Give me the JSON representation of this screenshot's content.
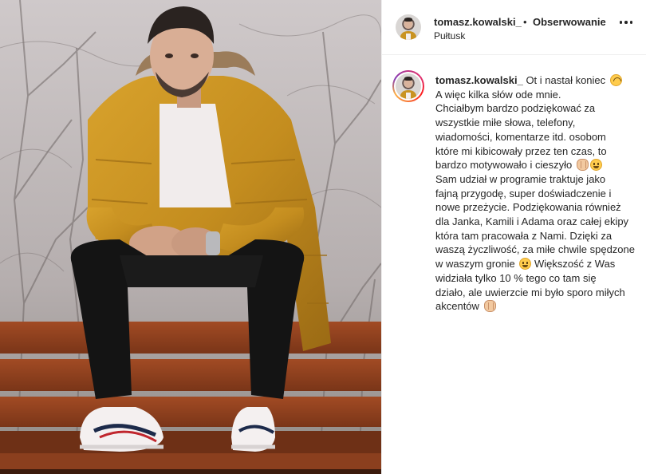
{
  "post": {
    "author": {
      "username": "tomasz.kowalski_",
      "follow_label": "Obserwowanie",
      "separator": "•",
      "location": "Pułtusk"
    },
    "caption": {
      "username": "tomasz.kowalski_",
      "lines": [
        " Ot i nastał koniec",
        "A więc kilka słów ode mnie.",
        "Chciałbym bardzo podziękować za",
        "wszystkie miłe słowa, telefony,",
        "wiadomości, komentarze itd. osobom",
        "które mi kibicowały przez ten czas, to",
        "bardzo motywowało i cieszyło",
        "Sam udział w programie traktuje jako",
        "fajną przygodę, super doświadczenie i",
        "nowe przeżycie. Podziękowania również",
        "dla Janka, Kamili i Adama oraz całej ekipy",
        "która tam pracowała z Nami. Dzięki za",
        "waszą życzliwość, za miłe chwile spędzone",
        "w waszym gronie",
        " Większość z Was",
        "widziała tylko 10 % tego co tam się",
        "działo, ale uwierzcie mi było sporo miłych",
        "akcentów"
      ]
    },
    "icons": {
      "more": "more-options-icon",
      "emoji_1": "upside-down-face-emoji",
      "emoji_2": "clapping-hands-emoji",
      "emoji_3": "smiling-face-emoji",
      "emoji_4": "slightly-smiling-face-emoji",
      "emoji_5": "clapping-hands-emoji"
    },
    "colors": {
      "jacket": "#c99321",
      "bench": "#8c3f1f",
      "text": "#262626"
    }
  }
}
